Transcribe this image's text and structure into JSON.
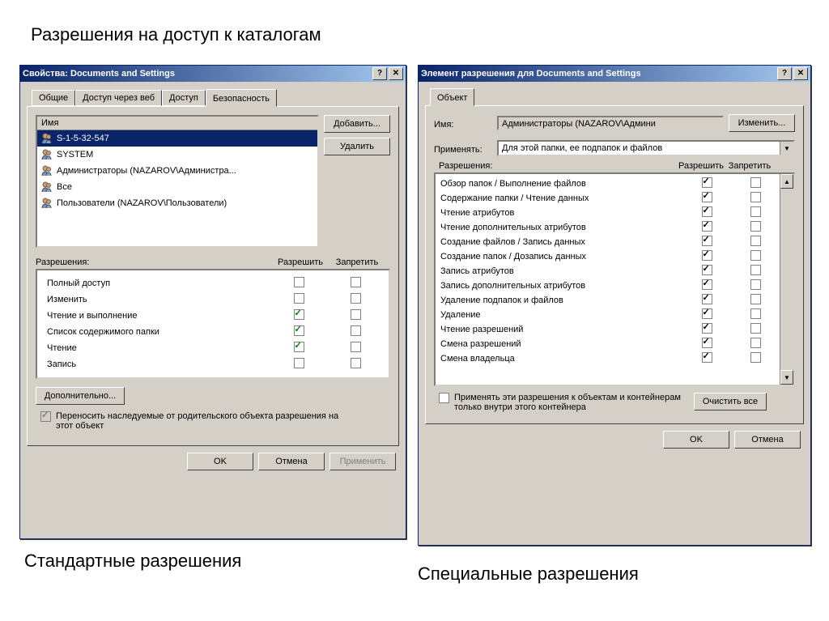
{
  "heading": "Разрешения на доступ к каталогам",
  "caption1": "Стандартные разрешения",
  "caption2": "Специальные разрешения",
  "win1": {
    "title": "Свойства: Documents and Settings",
    "tabs": [
      "Общие",
      "Доступ через веб",
      "Доступ",
      "Безопасность"
    ],
    "name_col": "Имя",
    "users": [
      "S-1-5-32-547",
      "SYSTEM",
      "Администраторы (NAZAROV\\Администра...",
      "Все",
      "Пользователи (NAZAROV\\Пользователи)"
    ],
    "add": "Добавить...",
    "remove": "Удалить",
    "perm_label": "Разрешения:",
    "col_allow": "Разрешить",
    "col_deny": "Запретить",
    "perms": [
      {
        "n": "Полный доступ",
        "a": false,
        "d": false
      },
      {
        "n": "Изменить",
        "a": false,
        "d": false
      },
      {
        "n": "Чтение и выполнение",
        "a": true,
        "d": false
      },
      {
        "n": "Список содержимого папки",
        "a": true,
        "d": false
      },
      {
        "n": "Чтение",
        "a": true,
        "d": false
      },
      {
        "n": "Запись",
        "a": false,
        "d": false
      }
    ],
    "advanced": "Дополнительно...",
    "inherit": "Переносить наследуемые от родительского объекта разрешения на этот объект",
    "ok": "OK",
    "cancel": "Отмена",
    "apply": "Применить"
  },
  "win2": {
    "title": "Элемент разрешения для Documents and Settings",
    "tab": "Объект",
    "name_lbl": "Имя:",
    "name_val": "Администраторы (NAZAROV\\Админи",
    "change": "Изменить...",
    "apply_lbl": "Применять:",
    "apply_val": "Для этой папки, ее подпапок и файлов",
    "perm_label": "Разрешения:",
    "col_allow": "Разрешить",
    "col_deny": "Запретить",
    "perms": [
      {
        "n": "Обзор папок / Выполнение файлов",
        "a": true,
        "d": false
      },
      {
        "n": "Содержание папки / Чтение данных",
        "a": true,
        "d": false
      },
      {
        "n": "Чтение атрибутов",
        "a": true,
        "d": false
      },
      {
        "n": "Чтение дополнительных атрибутов",
        "a": true,
        "d": false
      },
      {
        "n": "Создание файлов / Запись данных",
        "a": true,
        "d": false
      },
      {
        "n": "Создание папок / Дозапись данных",
        "a": true,
        "d": false
      },
      {
        "n": "Запись атрибутов",
        "a": true,
        "d": false
      },
      {
        "n": "Запись дополнительных атрибутов",
        "a": true,
        "d": false
      },
      {
        "n": "Удаление подпапок и файлов",
        "a": true,
        "d": false
      },
      {
        "n": "Удаление",
        "a": true,
        "d": false
      },
      {
        "n": "Чтение разрешений",
        "a": true,
        "d": false
      },
      {
        "n": "Смена разрешений",
        "a": true,
        "d": false
      },
      {
        "n": "Смена владельца",
        "a": true,
        "d": false
      }
    ],
    "scope": "Применять эти разрешения к объектам и контейнерам только внутри этого контейнера",
    "clear": "Очистить все",
    "ok": "OK",
    "cancel": "Отмена"
  }
}
